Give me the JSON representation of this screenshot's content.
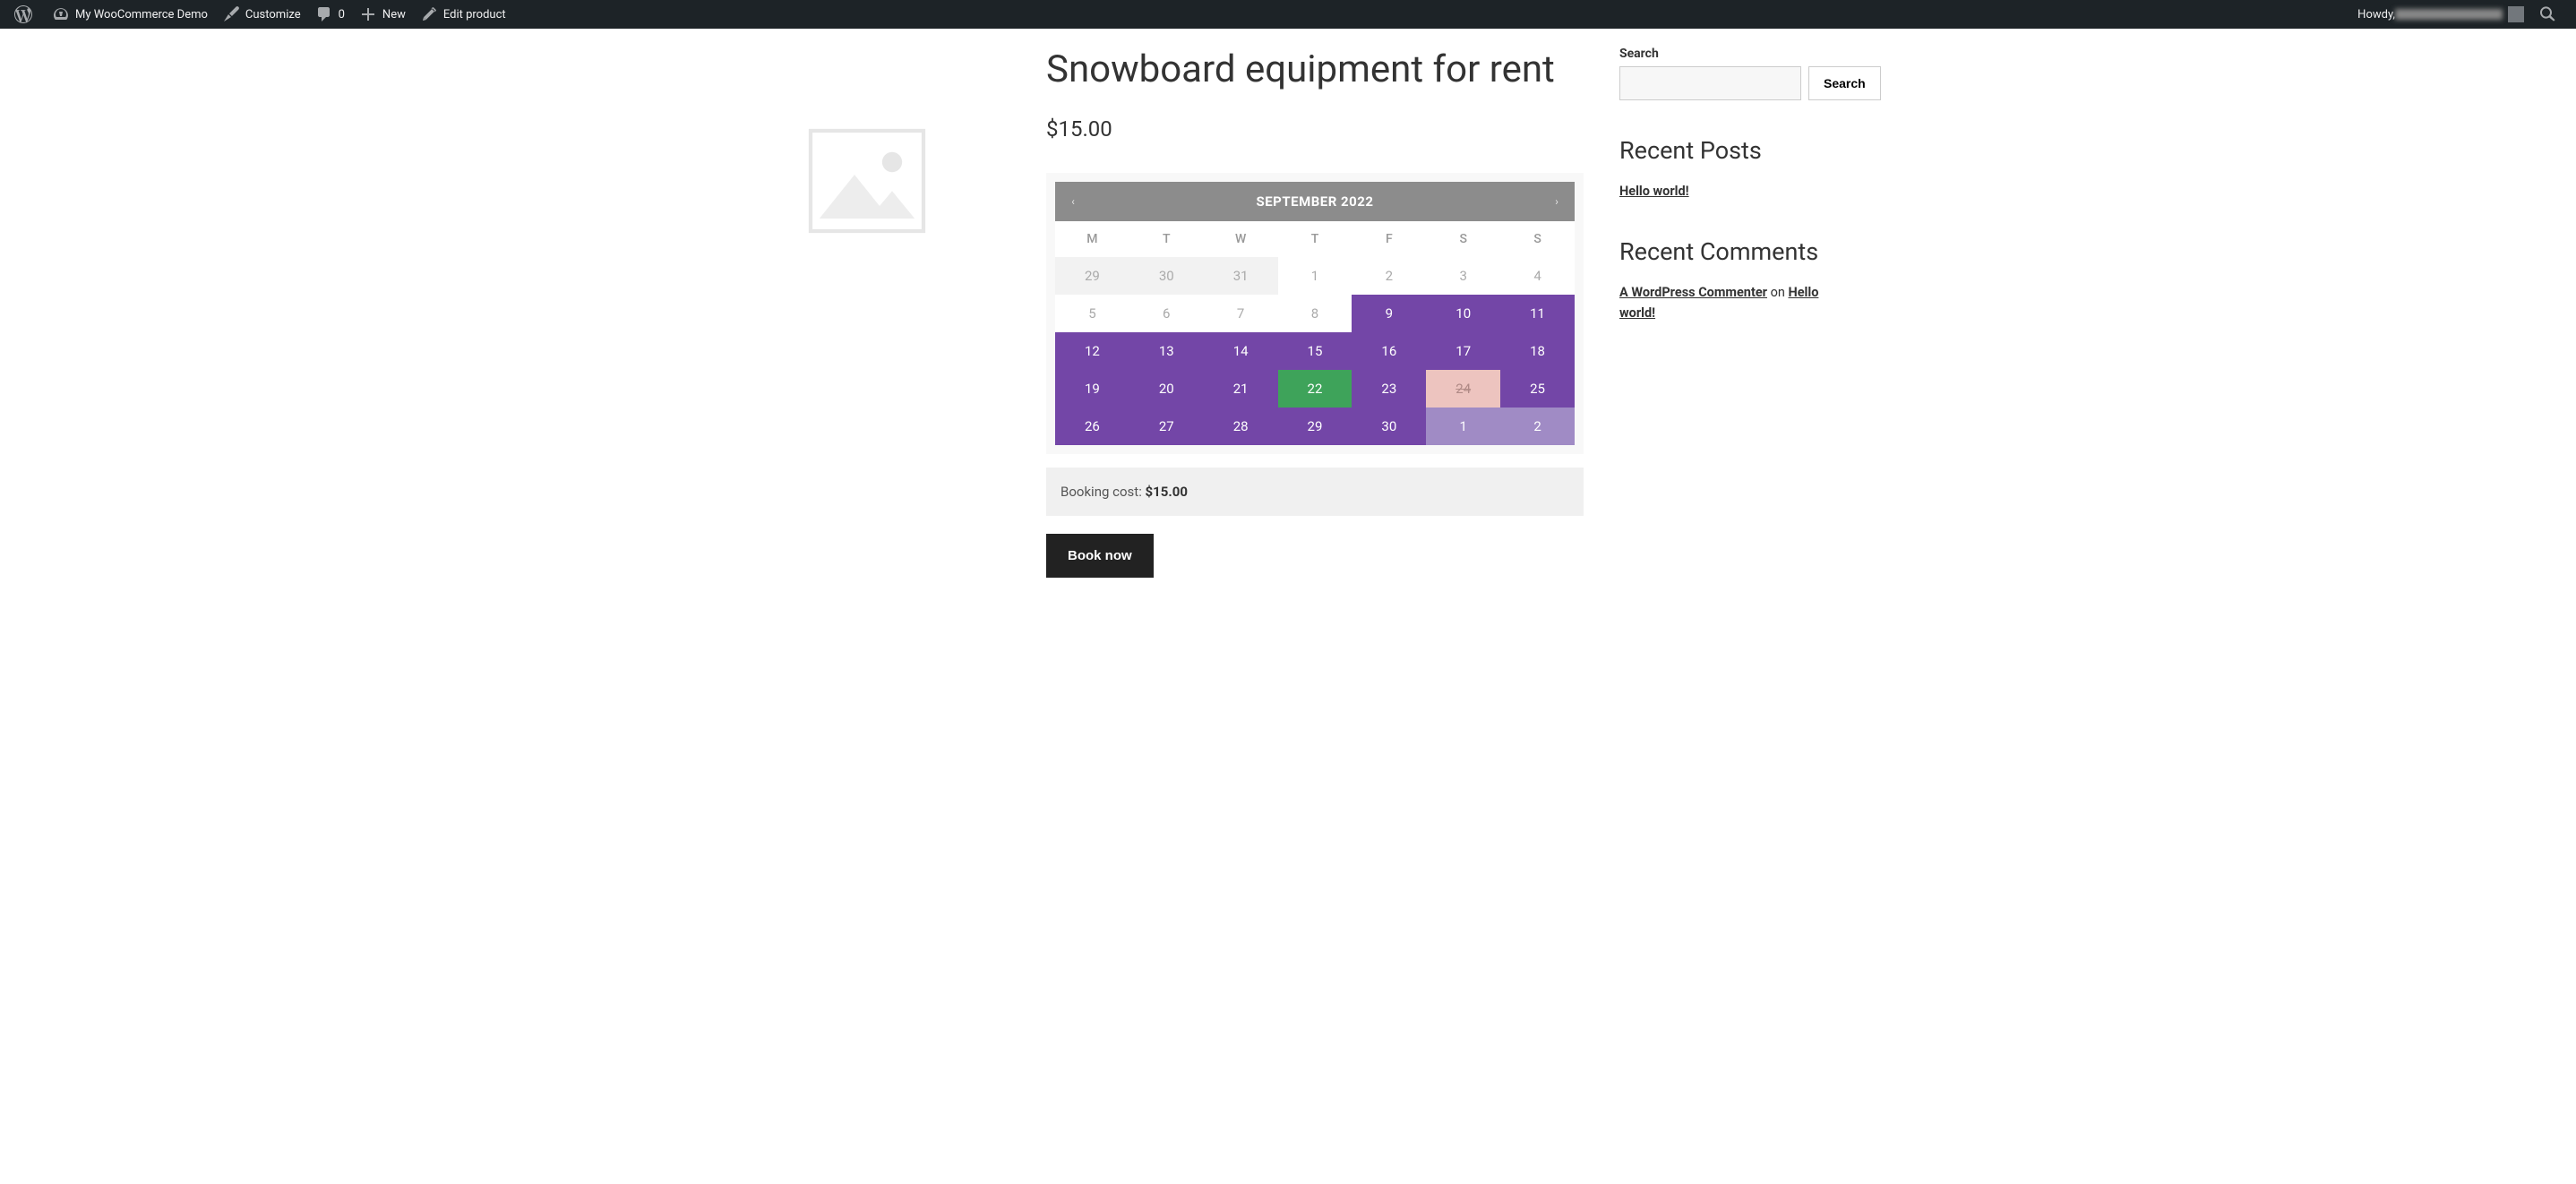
{
  "adminbar": {
    "site_name": "My WooCommerce Demo",
    "customize": "Customize",
    "comments": "0",
    "new": "New",
    "edit": "Edit product",
    "howdy": "Howdy,"
  },
  "product": {
    "title": "Snowboard equipment for rent",
    "price": "$15.00"
  },
  "calendar": {
    "month": "SEPTEMBER 2022",
    "dow": [
      "M",
      "T",
      "W",
      "T",
      "F",
      "S",
      "S"
    ],
    "cells": [
      {
        "n": "29",
        "state": "other"
      },
      {
        "n": "30",
        "state": "other"
      },
      {
        "n": "31",
        "state": "other"
      },
      {
        "n": "1",
        "state": "past"
      },
      {
        "n": "2",
        "state": "past"
      },
      {
        "n": "3",
        "state": "past"
      },
      {
        "n": "4",
        "state": "past"
      },
      {
        "n": "5",
        "state": "past"
      },
      {
        "n": "6",
        "state": "past"
      },
      {
        "n": "7",
        "state": "past"
      },
      {
        "n": "8",
        "state": "past"
      },
      {
        "n": "9",
        "state": "avail"
      },
      {
        "n": "10",
        "state": "avail"
      },
      {
        "n": "11",
        "state": "avail"
      },
      {
        "n": "12",
        "state": "avail"
      },
      {
        "n": "13",
        "state": "avail"
      },
      {
        "n": "14",
        "state": "avail"
      },
      {
        "n": "15",
        "state": "avail"
      },
      {
        "n": "16",
        "state": "avail"
      },
      {
        "n": "17",
        "state": "avail"
      },
      {
        "n": "18",
        "state": "avail"
      },
      {
        "n": "19",
        "state": "avail"
      },
      {
        "n": "20",
        "state": "avail"
      },
      {
        "n": "21",
        "state": "avail"
      },
      {
        "n": "22",
        "state": "selected"
      },
      {
        "n": "23",
        "state": "avail"
      },
      {
        "n": "24",
        "state": "unavail"
      },
      {
        "n": "25",
        "state": "avail"
      },
      {
        "n": "26",
        "state": "avail"
      },
      {
        "n": "27",
        "state": "avail"
      },
      {
        "n": "28",
        "state": "avail"
      },
      {
        "n": "29",
        "state": "avail"
      },
      {
        "n": "30",
        "state": "avail"
      },
      {
        "n": "1",
        "state": "other-next"
      },
      {
        "n": "2",
        "state": "other-next"
      }
    ]
  },
  "booking": {
    "cost_label": "Booking cost: ",
    "cost_value": "$15.00",
    "button": "Book now"
  },
  "sidebar": {
    "search": {
      "title": "Search",
      "button": "Search"
    },
    "recent_posts": {
      "title": "Recent Posts",
      "items": [
        "Hello world!"
      ]
    },
    "recent_comments": {
      "title": "Recent Comments",
      "author": "A WordPress Commenter",
      "on": " on ",
      "target": "Hello world!"
    }
  }
}
